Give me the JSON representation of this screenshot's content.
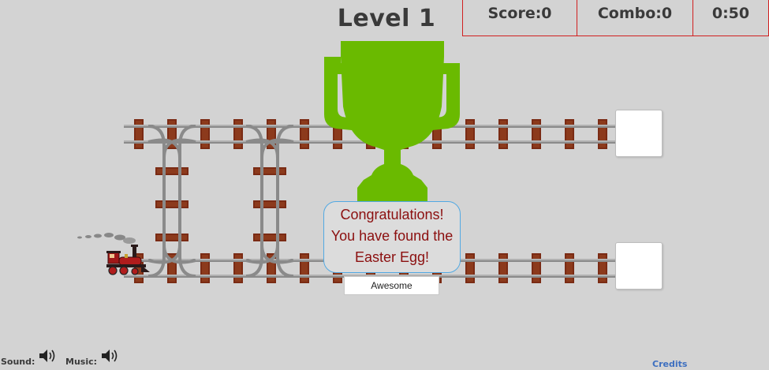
{
  "header": {
    "level_label": "Level 1",
    "score_label": "Score:0",
    "combo_label": "Combo:0",
    "timer_label": "0:50"
  },
  "dialog": {
    "message_line1": "Congratulations!",
    "message_line2": "You have found the",
    "message_line3": "Easter Egg!",
    "button_label": "Awesome"
  },
  "controls": {
    "sound_label": "Sound:",
    "music_label": "Music:",
    "sound_icon": "speaker-icon",
    "music_icon": "speaker-icon"
  },
  "footer": {
    "credits_label": "Credits"
  },
  "colors": {
    "background": "#d3d3d3",
    "trophy": "#6aba00",
    "hud_border": "#d12020",
    "dialog_text": "#8b0f0f",
    "dialog_border": "#52a9e3",
    "credits": "#3d6fc0",
    "sleeper": "#7a2b14",
    "rail": "#9a9a9a"
  }
}
